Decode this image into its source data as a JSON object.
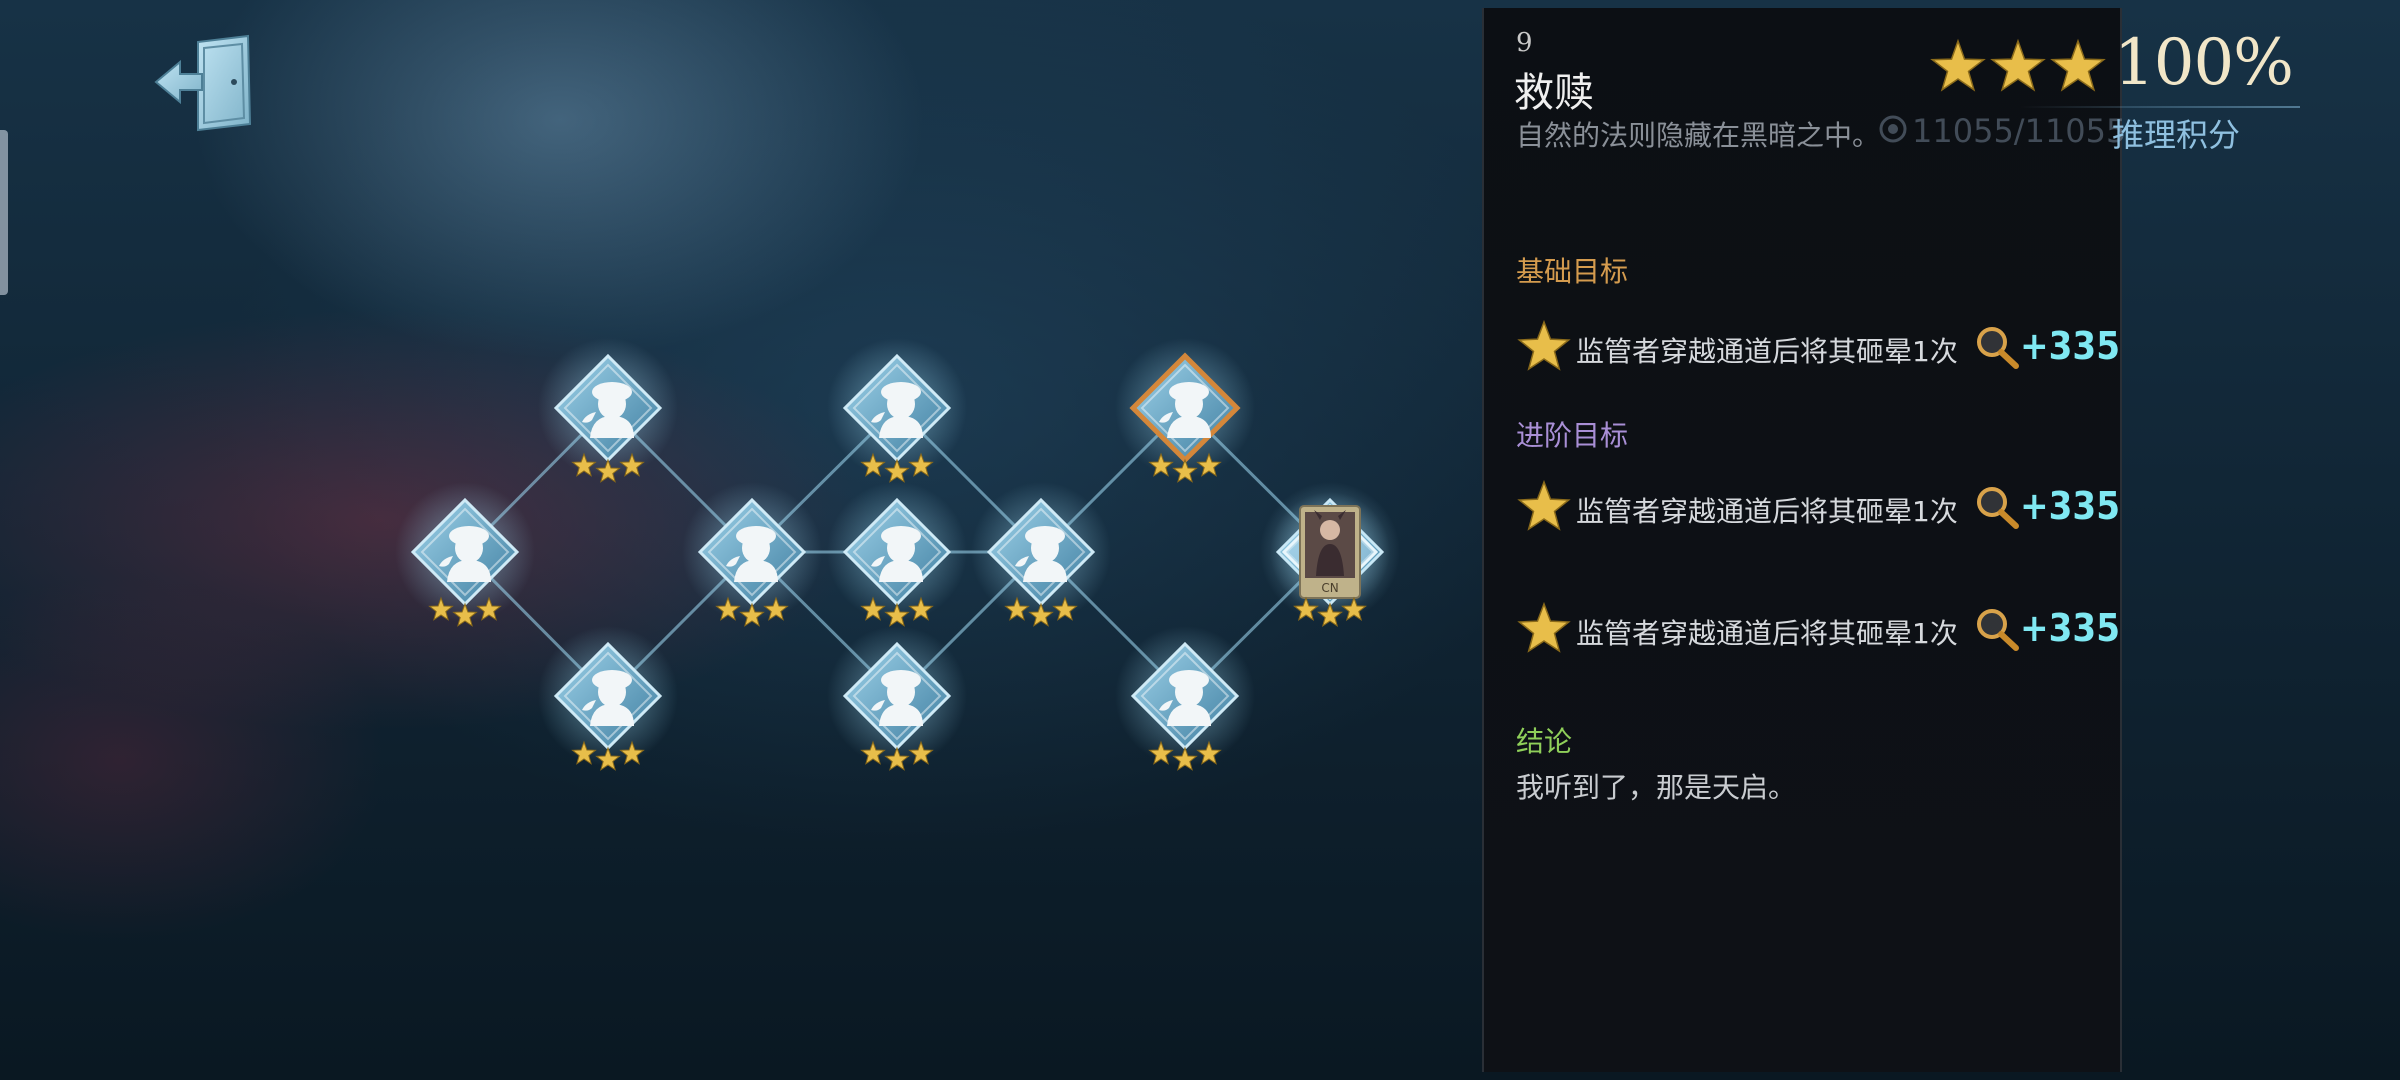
{
  "exit_button": {
    "icon": "exit-door-icon"
  },
  "tree": {
    "node_icon": "detective-silhouette-icon",
    "nodes": [
      {
        "id": "n1",
        "stars": 3,
        "state": "normal"
      },
      {
        "id": "n2",
        "stars": 3,
        "state": "normal"
      },
      {
        "id": "n3",
        "stars": 3,
        "state": "normal"
      },
      {
        "id": "n4",
        "stars": 3,
        "state": "normal"
      },
      {
        "id": "n5",
        "stars": 3,
        "state": "normal"
      },
      {
        "id": "n6",
        "stars": 3,
        "state": "normal"
      },
      {
        "id": "n7",
        "stars": 3,
        "state": "normal"
      },
      {
        "id": "n8",
        "stars": 3,
        "state": "normal"
      },
      {
        "id": "n9",
        "stars": 3,
        "state": "selected"
      },
      {
        "id": "n10",
        "stars": 3,
        "state": "normal"
      },
      {
        "id": "n11",
        "stars": 3,
        "state": "normal"
      },
      {
        "id": "n12",
        "stars": 3,
        "state": "character"
      }
    ],
    "character_card_label": "CN"
  },
  "panel": {
    "level_number": "9",
    "title": "救赎",
    "description": "自然的法则隐藏在黑暗之中。",
    "top_stars": 3,
    "completion": "100%",
    "score_value": "11055/11055",
    "score_label": "推理积分",
    "colors": {
      "basic": "#d49b4e",
      "advanced": "#a98fd6",
      "conclusion": "#8fcf5a",
      "points": "#7fe8f2",
      "star": "#e8be4a"
    },
    "basic_title": "基础目标",
    "basic_goals": [
      {
        "text": "监管者穿越通道后将其砸晕1次",
        "points": "+335",
        "icon": "magnifier-icon"
      }
    ],
    "advanced_title": "进阶目标",
    "advanced_goals": [
      {
        "text": "监管者穿越通道后将其砸晕1次",
        "points": "+335",
        "icon": "magnifier-icon"
      },
      {
        "text": "监管者穿越通道后将其砸晕1次",
        "points": "+335",
        "icon": "magnifier-icon"
      }
    ],
    "conclusion_title": "结论",
    "conclusion_text": "我听到了，那是天启。"
  }
}
